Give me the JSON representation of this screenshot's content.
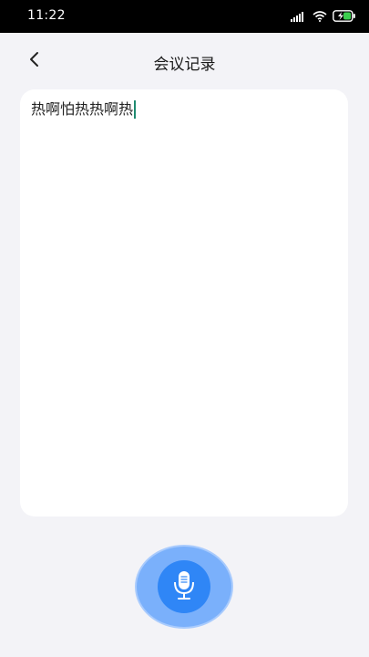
{
  "status_bar": {
    "time": "11:22",
    "icons": [
      "signal-icon",
      "wifi-icon",
      "battery-charging-icon"
    ]
  },
  "header": {
    "title": "会议记录",
    "back_icon": "chevron-left-icon"
  },
  "note": {
    "text": "热啊怕热热啊热"
  },
  "mic_button": {
    "icon": "microphone-icon",
    "colors": {
      "outer": "#7ab0fb",
      "inner": "#2f86f6"
    }
  }
}
